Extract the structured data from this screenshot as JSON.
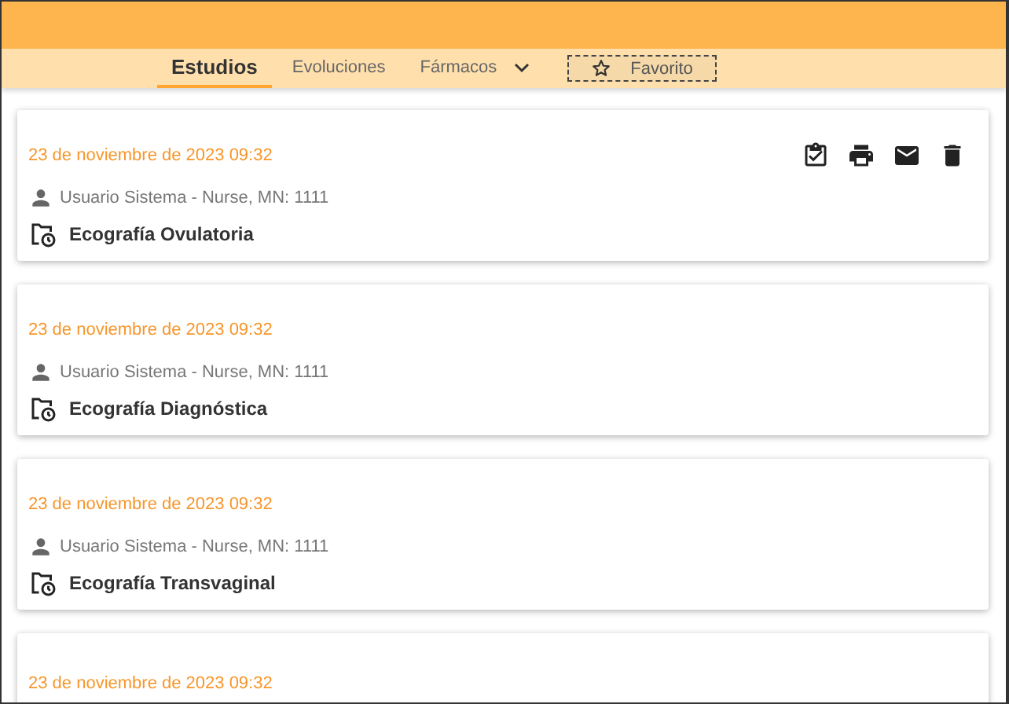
{
  "tabs": [
    {
      "label": "Estudios",
      "selected": true,
      "kind": "tab"
    },
    {
      "label": "Evoluciones",
      "selected": false,
      "kind": "tab"
    },
    {
      "label": "Fármacos",
      "selected": false,
      "kind": "dropdown"
    },
    {
      "label": "Favorito",
      "selected": false,
      "kind": "favorite"
    }
  ],
  "records": [
    {
      "date": "23 de noviembre de 2023 09:32",
      "author": "Usuario Sistema - Nurse, MN: 1111",
      "title": "Ecografía Ovulatoria",
      "actions": true
    },
    {
      "date": "23 de noviembre de 2023 09:32",
      "author": "Usuario Sistema - Nurse, MN: 1111",
      "title": "Ecografía Diagnóstica",
      "actions": false
    },
    {
      "date": "23 de noviembre de 2023 09:32",
      "author": "Usuario Sistema - Nurse, MN: 1111",
      "title": "Ecografía Transvaginal",
      "actions": false
    },
    {
      "date": "23 de noviembre de 2023 09:32",
      "actions": false
    }
  ]
}
